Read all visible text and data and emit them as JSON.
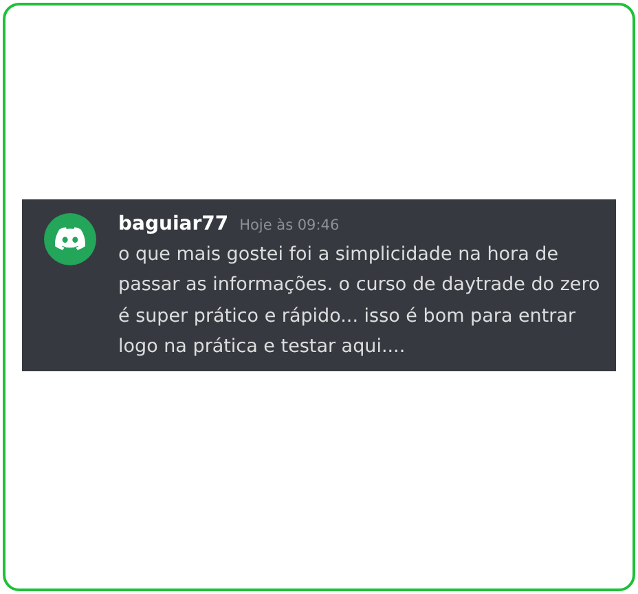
{
  "message": {
    "author": "baguiar77",
    "timestamp": "Hoje às 09:46",
    "text": "o que mais gostei foi a simplicidade na hora de passar as informações. o curso de daytrade do zero é super prático e rápido... isso é bom para entrar logo na prática e testar aqui...."
  }
}
